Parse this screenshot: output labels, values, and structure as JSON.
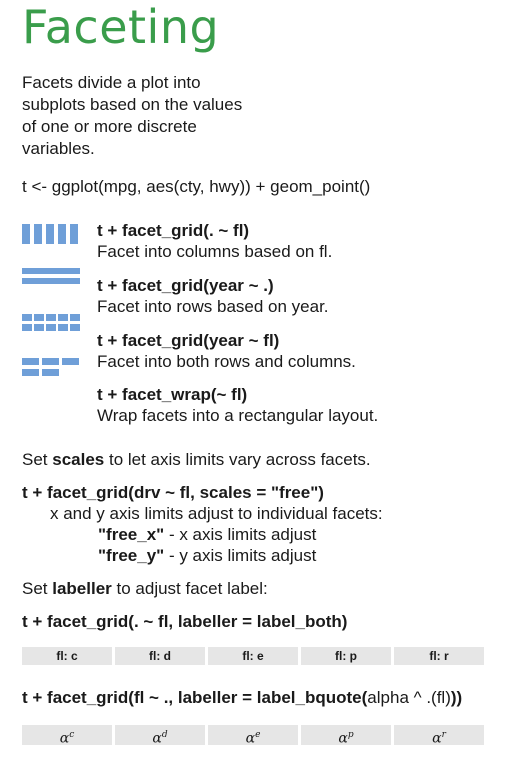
{
  "title": "Faceting",
  "intro": "Facets divide a plot into subplots based on the values of one or more discrete variables.",
  "setup_code": "t <- ggplot(mpg, aes(cty, hwy)) + geom_point()",
  "facets": [
    {
      "code": "t + facet_grid(. ~ fl)",
      "desc": "Facet into columns based on fl."
    },
    {
      "code": "t + facet_grid(year ~ .)",
      "desc": "Facet into rows based on year."
    },
    {
      "code": "t + facet_grid(year ~ fl)",
      "desc": "Facet into both rows and columns."
    },
    {
      "code": "t + facet_wrap(~ fl)",
      "desc": "Wrap facets into a rectangular layout."
    }
  ],
  "scales_text": {
    "pre": "Set ",
    "bold": "scales",
    "post": " to let axis limits vary across facets."
  },
  "scales_code": "t + facet_grid(drv ~ fl, scales = \"free\")",
  "scales_note": "x and y axis limits adjust to individual facets:",
  "free_x": {
    "value": "\"free_x\"",
    "desc": " - x axis limits adjust"
  },
  "free_y": {
    "value": "\"free_y\"",
    "desc": " - y axis limits adjust"
  },
  "labeller_text": {
    "pre": "Set ",
    "bold": "labeller",
    "post": " to adjust facet label:"
  },
  "labeller_code1": "t + facet_grid(. ~ fl, labeller = label_both)",
  "labels_both": [
    "fl: c",
    "fl: d",
    "fl: e",
    "fl: p",
    "fl: r"
  ],
  "labeller_code2": {
    "bold_start": "t + facet_grid(fl ~ .,  labeller = label_bquote(",
    "normal": "alpha ^ .(fl)",
    "bold_end": "))"
  },
  "labels_greek": [
    {
      "sym": "α",
      "sup": "c"
    },
    {
      "sym": "α",
      "sup": "d"
    },
    {
      "sym": "α",
      "sup": "e"
    },
    {
      "sym": "α",
      "sup": "p"
    },
    {
      "sym": "α",
      "sup": "r"
    }
  ],
  "colors": {
    "title": "#3a9d4b",
    "icon": "#6f9fd8",
    "chip": "#e6e6e6"
  }
}
